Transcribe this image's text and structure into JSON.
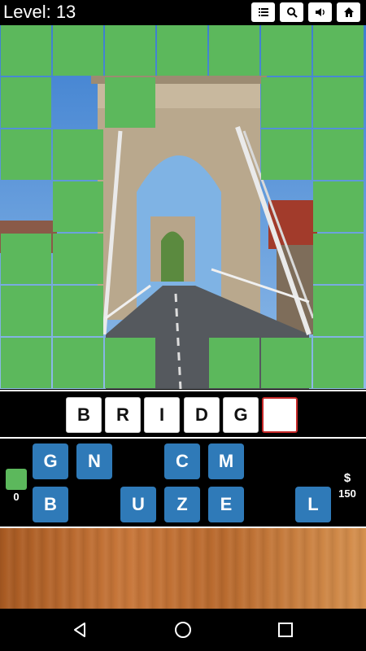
{
  "header": {
    "level_text": "Level: 13",
    "icons": [
      "list-icon",
      "search-icon",
      "sound-icon",
      "home-icon"
    ]
  },
  "puzzle": {
    "tile_color": "#5cb85c",
    "grid_cols": 7,
    "grid_rows": 7,
    "covered_tiles": [
      [
        0,
        0
      ],
      [
        1,
        0
      ],
      [
        2,
        0
      ],
      [
        3,
        0
      ],
      [
        4,
        0
      ],
      [
        5,
        0
      ],
      [
        6,
        0
      ],
      [
        0,
        1
      ],
      [
        2,
        1
      ],
      [
        5,
        1
      ],
      [
        6,
        1
      ],
      [
        0,
        2
      ],
      [
        1,
        2
      ],
      [
        5,
        2
      ],
      [
        6,
        2
      ],
      [
        1,
        3
      ],
      [
        6,
        3
      ],
      [
        0,
        4
      ],
      [
        1,
        4
      ],
      [
        6,
        4
      ],
      [
        0,
        5
      ],
      [
        1,
        5
      ],
      [
        6,
        5
      ],
      [
        0,
        6
      ],
      [
        1,
        6
      ],
      [
        2,
        6
      ],
      [
        4,
        6
      ],
      [
        5,
        6
      ],
      [
        6,
        6
      ]
    ]
  },
  "answer": {
    "slots": [
      "B",
      "R",
      "I",
      "D",
      "G",
      ""
    ]
  },
  "letters": {
    "row1": [
      "G",
      "N",
      "",
      "C",
      "M",
      ""
    ],
    "row2": [
      "B",
      "",
      "U",
      "Z",
      "E",
      "",
      "L"
    ]
  },
  "hints": {
    "count": "0"
  },
  "coins": {
    "symbol": "$",
    "amount": "150"
  },
  "colors": {
    "key_blue": "#2f7ab8",
    "empty_slot_border": "#c62828"
  }
}
